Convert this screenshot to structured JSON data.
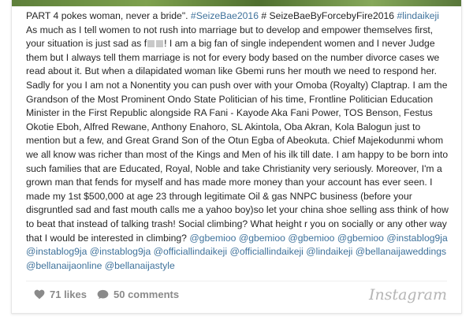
{
  "post": {
    "caption": {
      "t1": "PART 4 pokes woman, never a bride\". ",
      "tag1": "#SeizeBae2016",
      "t2": " # SeizeBaeByForcebyFire2016 ",
      "tag2": "#lindaikeji",
      "t3": " As much as I tell women to not rush into marriage but to develop and empower themselves first, your situation is just sad as f",
      "t4": "! I am a big fan of single independent women and I never Judge them but I always tell them marriage is not for every body based on the number divorce cases we read about it. But when a dilapidated woman like Gbemi runs her mouth we need to respond her. Sadly for you I am not a Nonentity you can push over with your Omoba (Royalty) Claptrap. I am the Grandson of the Most Prominent Ondo State Politician of his time, Frontline Politician Education Minister in the First Republic alongside RA Fani - Kayode Aka Fani Power, TOS Benson, Festus Okotie Eboh, Alfred Rewane, Anthony Enahoro, SL Akintola, Oba Akran, Kola Balogun just to mention but a few, and Great Grand Son of the Otun Egba of Abeokuta. Chief Majekodunmi whom we all know was richer than most of the Kings and Men of his ilk till date. I am happy to be born into such families that are Educated, Royal, Noble and take Christianity very seriously. Moreover, I'm a grown man that fends for myself and has made more money than your account has ever seen. I made my 1st $500,000 at age 23 through legitimate Oil & gas NNPC business (before your disgruntled sad and fast mouth calls me a yahoo boy)so let your china shoe selling ass think of how to beat that instead of talking trash! Social climbing? What height r you on socially or any other way that I would be interested in climbing? ",
      "mentions": "@gbemioo @gbemioo @gbemioo @gbemioo @instablog9ja @instablog9ja @instablog9ja @officiallindaikeji @officiallindaikeji @lindaikeji @bellanaijaweddings @bellanaijaonline @bellanaijastyle"
    },
    "likes_label": "71 likes",
    "comments_label": "50 comments",
    "brand": "Instagram"
  },
  "icons": [
    "heart-icon",
    "comment-icon"
  ],
  "colors": {
    "tag": "#3f729b",
    "text": "#262626",
    "meta": "#8a8a8a"
  }
}
